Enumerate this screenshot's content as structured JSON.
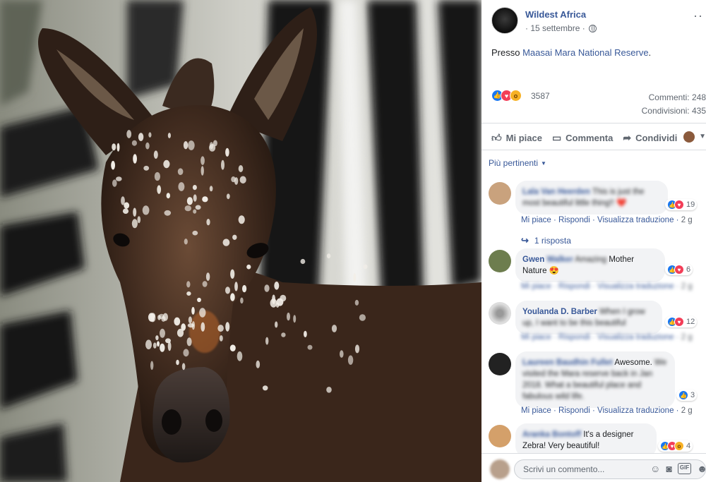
{
  "colors": {
    "link": "#385898",
    "meta": "#606770",
    "like": "#1877f2",
    "love": "#f33e58",
    "wow": "#f7b125",
    "bubble": "#f2f3f5"
  },
  "post": {
    "page_name": "Wildest Africa",
    "date": "· 15 settembre ·",
    "privacy_icon": "globe-icon",
    "text_prefix": "Presso ",
    "location": "Maasai Mara National Reserve",
    "text_suffix": "."
  },
  "reactions": {
    "icons": [
      "like-icon",
      "love-icon",
      "wow-icon"
    ],
    "count": "3587",
    "comments": "Commenti: 248",
    "shares": "Condivisioni: 435"
  },
  "actions": {
    "like": "Mi piace",
    "comment": "Commenta",
    "share": "Condividi"
  },
  "sort_label": "Più pertinenti",
  "comments": [
    {
      "name": "Lala Van Heerden",
      "text": "This is just the most beautiful little thing!! ❤️",
      "react_count": "19",
      "actions": "Mi piace · Rispondi · Visualizza traduzione ·",
      "time": "2 g",
      "replies": "1 risposta"
    },
    {
      "name": "Gwen",
      "name_blur": "Walker",
      "text_blur": "Amazing",
      "text": "Mother Nature 😍",
      "react_count": "6",
      "actions": "Mi piace · Rispondi · Visualizza traduzione ·",
      "time": "2 g"
    },
    {
      "name": "Youlanda D. Barber",
      "text": "When I grow up, I want to be this beautiful",
      "react_count": "12",
      "actions": "Mi piace · Rispondi · Visualizza traduzione ·",
      "time": "2 g"
    },
    {
      "name": "Laureen Baudhin Fullet",
      "text": "Awesome.",
      "text_blur": "We visited the Mara reserve back in Jan 2018. What a beautiful place and fabulous wild life.",
      "react_count": "3",
      "actions": "Mi piace · Rispondi · Visualizza traduzione ·",
      "time": "2 g"
    },
    {
      "name": "Aranka Bontoff",
      "text": "It's a designer Zebra! Very beautiful!",
      "react_count": "4"
    }
  ],
  "composer": {
    "placeholder": "Scrivi un commento...",
    "icons": [
      "emoji-icon",
      "camera-icon",
      "gif-icon",
      "sticker-icon"
    ],
    "gif_label": "GIF"
  }
}
